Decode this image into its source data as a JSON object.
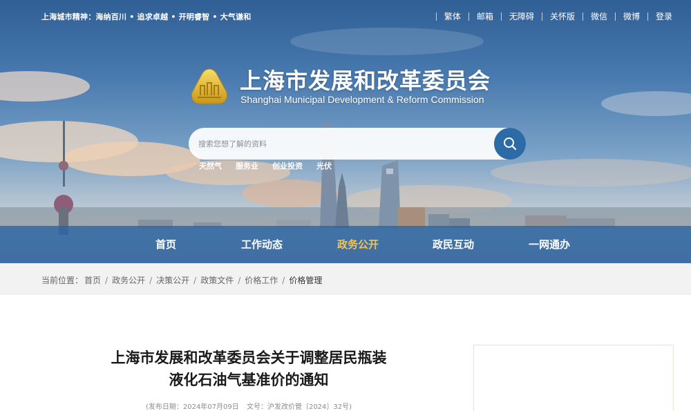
{
  "header": {
    "slogan": "上海城市精神：海纳百川 • 追求卓越 • 开明睿智 • 大气谦和",
    "top_links": [
      "繁体",
      "邮箱",
      "无障碍",
      "关怀版",
      "微信",
      "微博",
      "登录"
    ]
  },
  "brand": {
    "name_cn": "上海市发展和改革委员会",
    "name_en": "Shanghai Municipal Development & Reform Commission"
  },
  "search": {
    "placeholder": "搜索您想了解的资料",
    "value": "",
    "hot_words": [
      "天然气",
      "服务业",
      "创业投资",
      "光伏"
    ]
  },
  "nav": {
    "items": [
      "首页",
      "工作动态",
      "政务公开",
      "政民互动",
      "一网通办"
    ],
    "active": "政务公开"
  },
  "breadcrumb": {
    "prefix": "当前位置：",
    "items": [
      "首页",
      "政务公开",
      "决策公开",
      "政策文件",
      "价格工作",
      "价格管理"
    ]
  },
  "article": {
    "title_line1": "上海市发展和改革委员会关于调整居民瓶装",
    "title_line2": "液化石油气基准价的通知",
    "publish_date": "(发布日期：2024年07月09日",
    "doc_number": "文号：沪发改价管〔2024〕32号)"
  },
  "colors": {
    "primary_blue": "#2c6ba6",
    "nav_active": "#f6c44d",
    "breadcrumb_bg": "#f2f2f2"
  }
}
